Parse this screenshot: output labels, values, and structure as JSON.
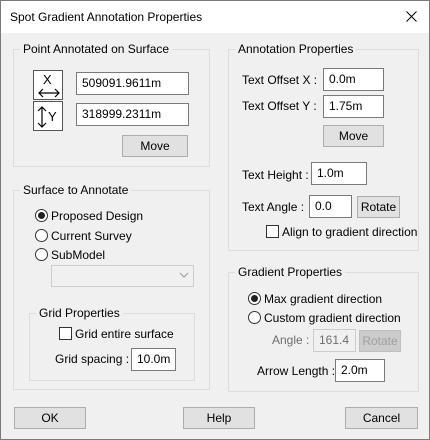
{
  "window": {
    "title": "Spot Gradient Annotation Properties"
  },
  "point_group": {
    "title": "Point Annotated on Surface",
    "x_icon_letter": "X",
    "y_icon_letter": "Y",
    "x_value": "509091.9611m",
    "y_value": "318999.2311m",
    "move_label": "Move"
  },
  "surface_group": {
    "title": "Surface to Annotate",
    "options": [
      {
        "label": "Proposed Design",
        "selected": true
      },
      {
        "label": "Current Survey",
        "selected": false
      },
      {
        "label": "SubModel",
        "selected": false
      }
    ],
    "submodel_value": ""
  },
  "grid_group": {
    "title": "Grid Properties",
    "grid_entire_label": "Grid entire surface",
    "grid_entire_checked": false,
    "spacing_label": "Grid spacing :",
    "spacing_value": "10.0m"
  },
  "annotation_group": {
    "title": "Annotation Properties",
    "offset_x_label": "Text Offset X :",
    "offset_x_value": "0.0m",
    "offset_y_label": "Text Offset Y :",
    "offset_y_value": "1.75m",
    "move_label": "Move",
    "height_label": "Text Height :",
    "height_value": "1.0m",
    "angle_label": "Text Angle :",
    "angle_value": "0.0",
    "rotate_label": "Rotate",
    "align_label": "Align to gradient direction",
    "align_checked": false
  },
  "gradient_group": {
    "title": "Gradient Properties",
    "options": [
      {
        "label": "Max gradient direction",
        "selected": true
      },
      {
        "label": "Custom gradient direction",
        "selected": false
      }
    ],
    "angle_label": "Angle :",
    "angle_value": "161.4",
    "rotate_label": "Rotate",
    "arrow_length_label": "Arrow Length :",
    "arrow_length_value": "2.0m"
  },
  "footer": {
    "ok_label": "OK",
    "help_label": "Help",
    "cancel_label": "Cancel"
  }
}
